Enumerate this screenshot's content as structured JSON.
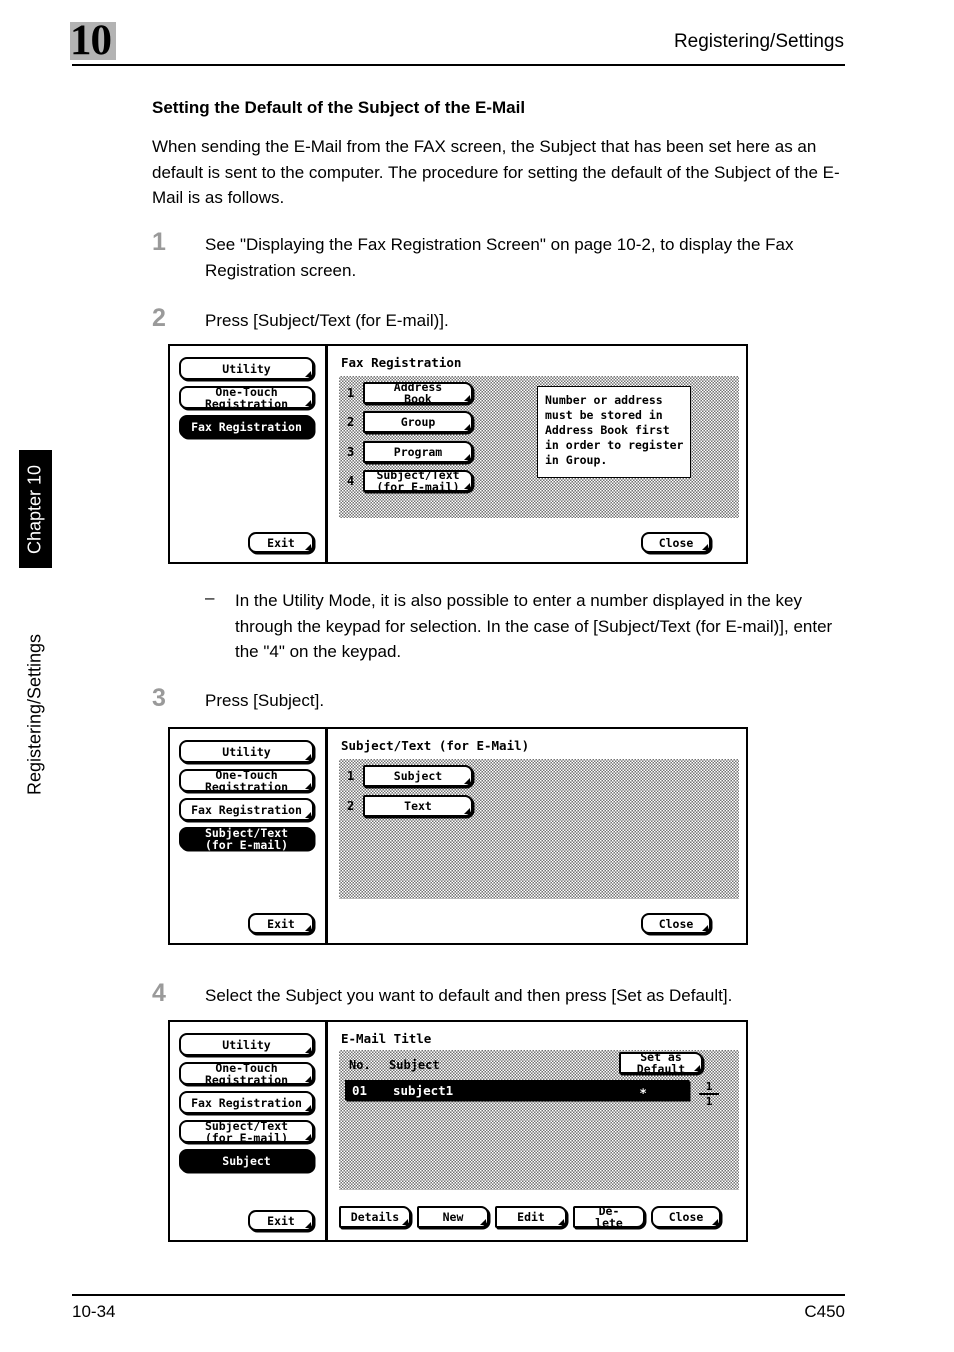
{
  "page": {
    "chapter_number": "10",
    "header_title": "Registering/Settings",
    "side_tab_label": "Chapter 10",
    "side_section_label": "Registering/Settings",
    "footer_page": "10-34",
    "footer_model": "C450"
  },
  "section": {
    "heading": "Setting the Default of the Subject of the E-Mail",
    "intro": "When sending the E-Mail from the FAX screen, the Subject that has been set here as an default is sent to the computer. The procedure for setting the default of the Subject of the E-Mail is as follows."
  },
  "steps": {
    "one": {
      "number": "1",
      "text": "See \"Displaying the Fax Registration Screen\" on page 10-2, to display the Fax Registration screen."
    },
    "two": {
      "number": "2",
      "text": "Press [Subject/Text (for E-mail)]."
    },
    "three": {
      "number": "3",
      "text": "Press [Subject]."
    },
    "four": {
      "number": "4",
      "text": "Select the Subject you want to default and then press [Set as Default]."
    }
  },
  "note": {
    "dash": "–",
    "text": "In the Utility Mode, it is also possible to enter a number displayed in the key through the keypad for selection. In the case of [Subject/Text (for E-mail)], enter the \"4\" on the keypad."
  },
  "screen1": {
    "title": "Fax Registration",
    "sidebar": [
      {
        "label": "Utility",
        "selected": false
      },
      {
        "label": "One-Touch\nRegistration",
        "selected": false
      },
      {
        "label": "Fax Registration",
        "selected": true
      }
    ],
    "exit_label": "Exit",
    "close_label": "Close",
    "menu": [
      {
        "index": "1",
        "label": "Address\nBook"
      },
      {
        "index": "2",
        "label": "Group"
      },
      {
        "index": "3",
        "label": "Program"
      },
      {
        "index": "4",
        "label": "Subject/Text\n(for E-mail)"
      }
    ],
    "info_text": "Number or address\nmust be stored in\nAddress Book first\nin order to register\nin Group."
  },
  "screen2": {
    "title": "Subject/Text (for E-Mail)",
    "sidebar": [
      {
        "label": "Utility",
        "selected": false
      },
      {
        "label": "One-Touch\nRegistration",
        "selected": false
      },
      {
        "label": "Fax Registration",
        "selected": false
      },
      {
        "label": "Subject/Text\n(for E-mail)",
        "selected": true
      }
    ],
    "exit_label": "Exit",
    "close_label": "Close",
    "menu": [
      {
        "index": "1",
        "label": "Subject"
      },
      {
        "index": "2",
        "label": "Text"
      }
    ]
  },
  "screen3": {
    "title": "E-Mail Title",
    "sidebar": [
      {
        "label": "Utility",
        "selected": false
      },
      {
        "label": "One-Touch\nRegistration",
        "selected": false
      },
      {
        "label": "Fax Registration",
        "selected": false
      },
      {
        "label": "Subject/Text\n(for E-mail)",
        "selected": false
      },
      {
        "label": "Subject",
        "selected": true
      }
    ],
    "exit_label": "Exit",
    "set_default_label": "Set as\nDefault",
    "col_no": "No.",
    "col_subject": "Subject",
    "row": {
      "no": "01",
      "subject": "subject1",
      "mark": "∗"
    },
    "pager_current": "1",
    "pager_total": "1",
    "bottom_buttons": [
      {
        "label": "Details"
      },
      {
        "label": "New"
      },
      {
        "label": "Edit"
      },
      {
        "label": "De-\nlete"
      },
      {
        "label": "Close"
      }
    ]
  }
}
